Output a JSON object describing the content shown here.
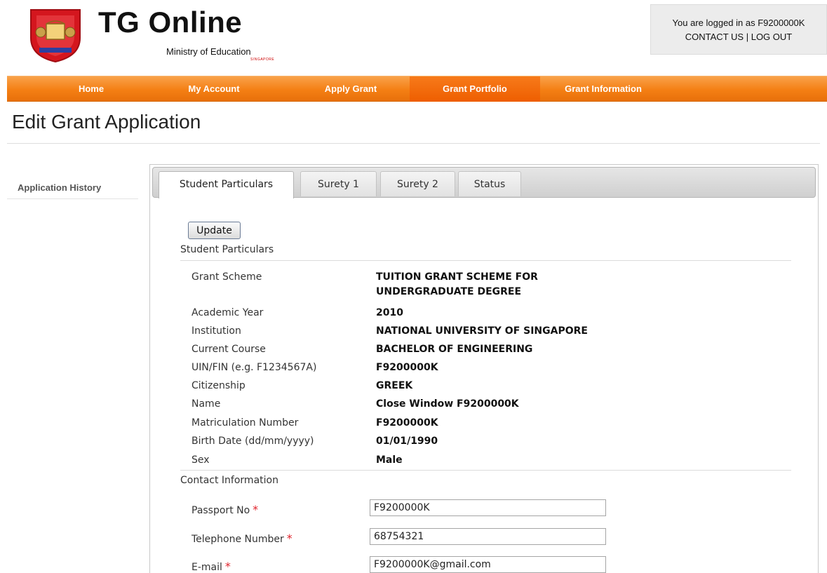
{
  "header": {
    "brand_title": "TG Online",
    "brand_subtitle": "Ministry of Education",
    "brand_country": "SINGAPORE",
    "login_text": "You are logged in as F9200000K",
    "contact_label": "CONTACT US",
    "separator": "|",
    "logout_label": "LOG OUT"
  },
  "nav": {
    "items": [
      {
        "label": "Home"
      },
      {
        "label": "My Account"
      },
      {
        "label": "Apply Grant"
      },
      {
        "label": "Grant Portfolio",
        "active": true
      },
      {
        "label": "Grant Information"
      }
    ],
    "colors": {
      "bar": "#f47f14",
      "active": "#ee5e00"
    }
  },
  "page": {
    "title": "Edit Grant Application"
  },
  "sidebar": {
    "items": [
      {
        "label": "Application History"
      }
    ]
  },
  "tabs": [
    {
      "label": "Student Particulars",
      "active": true
    },
    {
      "label": "Surety 1"
    },
    {
      "label": "Surety 2"
    },
    {
      "label": "Status"
    }
  ],
  "form": {
    "update_label": "Update",
    "student_section": "Student Particulars",
    "particulars": [
      {
        "label": "Grant Scheme",
        "value_line1": "TUITION GRANT SCHEME FOR",
        "value_line2": "UNDERGRADUATE DEGREE"
      },
      {
        "label": "Academic Year",
        "value": "2010"
      },
      {
        "label": "Institution",
        "value": "NATIONAL UNIVERSITY OF SINGAPORE"
      },
      {
        "label": "Current Course",
        "value": "BACHELOR OF ENGINEERING"
      },
      {
        "label": "UIN/FIN (e.g. F1234567A)",
        "value": "F9200000K"
      },
      {
        "label": "Citizenship",
        "value": "GREEK"
      },
      {
        "label": "Name",
        "value": "Close Window F9200000K"
      },
      {
        "label": "Matriculation Number",
        "value": "F9200000K"
      },
      {
        "label": "Birth Date (dd/mm/yyyy)",
        "value": "01/01/1990"
      },
      {
        "label": "Sex",
        "value": "Male"
      }
    ],
    "contact_section": "Contact Information",
    "required_mark": "*",
    "contact_fields": [
      {
        "label": "Passport No",
        "value": "F9200000K"
      },
      {
        "label": "Telephone Number",
        "value": "68754321"
      },
      {
        "label": "E-mail",
        "value": "F9200000K@gmail.com"
      }
    ]
  }
}
